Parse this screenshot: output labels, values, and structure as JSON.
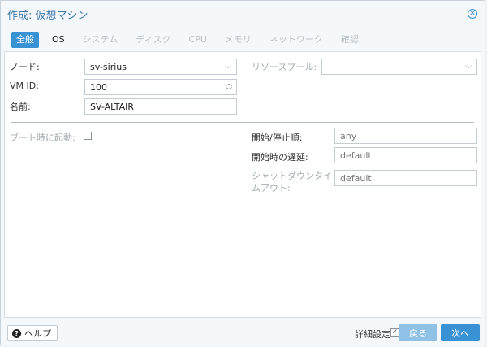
{
  "window": {
    "title": "作成: 仮想マシン"
  },
  "tabs": [
    {
      "label": "全般",
      "state": "active"
    },
    {
      "label": "OS",
      "state": "enabled"
    },
    {
      "label": "システム",
      "state": "disabled"
    },
    {
      "label": "ディスク",
      "state": "disabled"
    },
    {
      "label": "CPU",
      "state": "disabled"
    },
    {
      "label": "メモリ",
      "state": "disabled"
    },
    {
      "label": "ネットワーク",
      "state": "disabled"
    },
    {
      "label": "確認",
      "state": "disabled"
    }
  ],
  "general": {
    "node_label": "ノード:",
    "node_value": "sv-sirius",
    "vmid_label": "VM ID:",
    "vmid_value": "100",
    "name_label": "名前:",
    "name_value": "SV-ALTAIR",
    "pool_label": "リソースプール:",
    "pool_value": ""
  },
  "advanced": {
    "boot_label": "ブート時に起動:",
    "order_label": "開始/停止順:",
    "order_value": "any",
    "delay_label": "開始時の遅延:",
    "delay_value": "default",
    "shutdown_label_1": "シャットダウンタイ",
    "shutdown_label_2": "ムアウト:",
    "shutdown_value": "default"
  },
  "footer": {
    "help_label": "ヘルプ",
    "advanced_label": "詳細設定",
    "advanced_checked": "✓",
    "back_label": "戻る",
    "next_label": "次へ"
  },
  "colors": {
    "accent": "#3892d4",
    "accent_disabled": "#8fc2e6",
    "title": "#3d79ad"
  }
}
